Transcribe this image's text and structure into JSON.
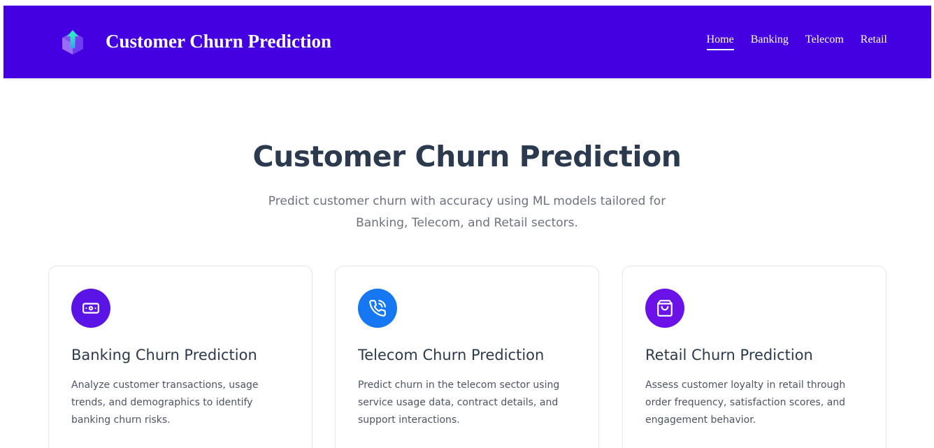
{
  "header": {
    "brand": "Customer Churn Prediction",
    "logo_icon": "cube-arrow-logo",
    "nav": [
      {
        "label": "Home",
        "active": true
      },
      {
        "label": "Banking",
        "active": false
      },
      {
        "label": "Telecom",
        "active": false
      },
      {
        "label": "Retail",
        "active": false
      }
    ],
    "background_color": "#4400e0"
  },
  "hero": {
    "title": "Customer Churn Prediction",
    "subtitle": "Predict customer churn with accuracy using ML models tailored for Banking, Telecom, and Retail sectors."
  },
  "cards": [
    {
      "icon": "banknote-icon",
      "icon_color": "#5b14e6",
      "title": "Banking Churn Prediction",
      "description": "Analyze customer transactions, usage trends, and demographics to identify banking churn risks."
    },
    {
      "icon": "phone-call-icon",
      "icon_color": "#1677f2",
      "title": "Telecom Churn Prediction",
      "description": "Predict churn in the telecom sector using service usage data, contract details, and support interactions."
    },
    {
      "icon": "shopping-bag-icon",
      "icon_color": "#6a12e8",
      "title": "Retail Churn Prediction",
      "description": "Assess customer loyalty in retail through order frequency, satisfaction scores, and engagement behavior."
    }
  ]
}
